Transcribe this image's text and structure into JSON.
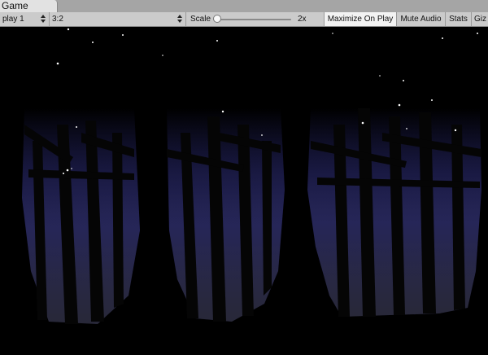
{
  "tab": {
    "title": "Game"
  },
  "toolbar": {
    "display": "play 1",
    "aspect": "3:2",
    "scale_label": "Scale",
    "scale_value": "2x",
    "scale_fraction": 0.0,
    "maximize_label": "Maximize On Play",
    "mute_label": "Mute Audio",
    "stats_label": "Stats",
    "gizmos_label": "Giz"
  },
  "colors": {
    "sky": "#000000",
    "night_blue": "#0b0b5a",
    "tree_dark": "#0a0a0a",
    "fog": "#555555",
    "star": "#ffffff"
  }
}
